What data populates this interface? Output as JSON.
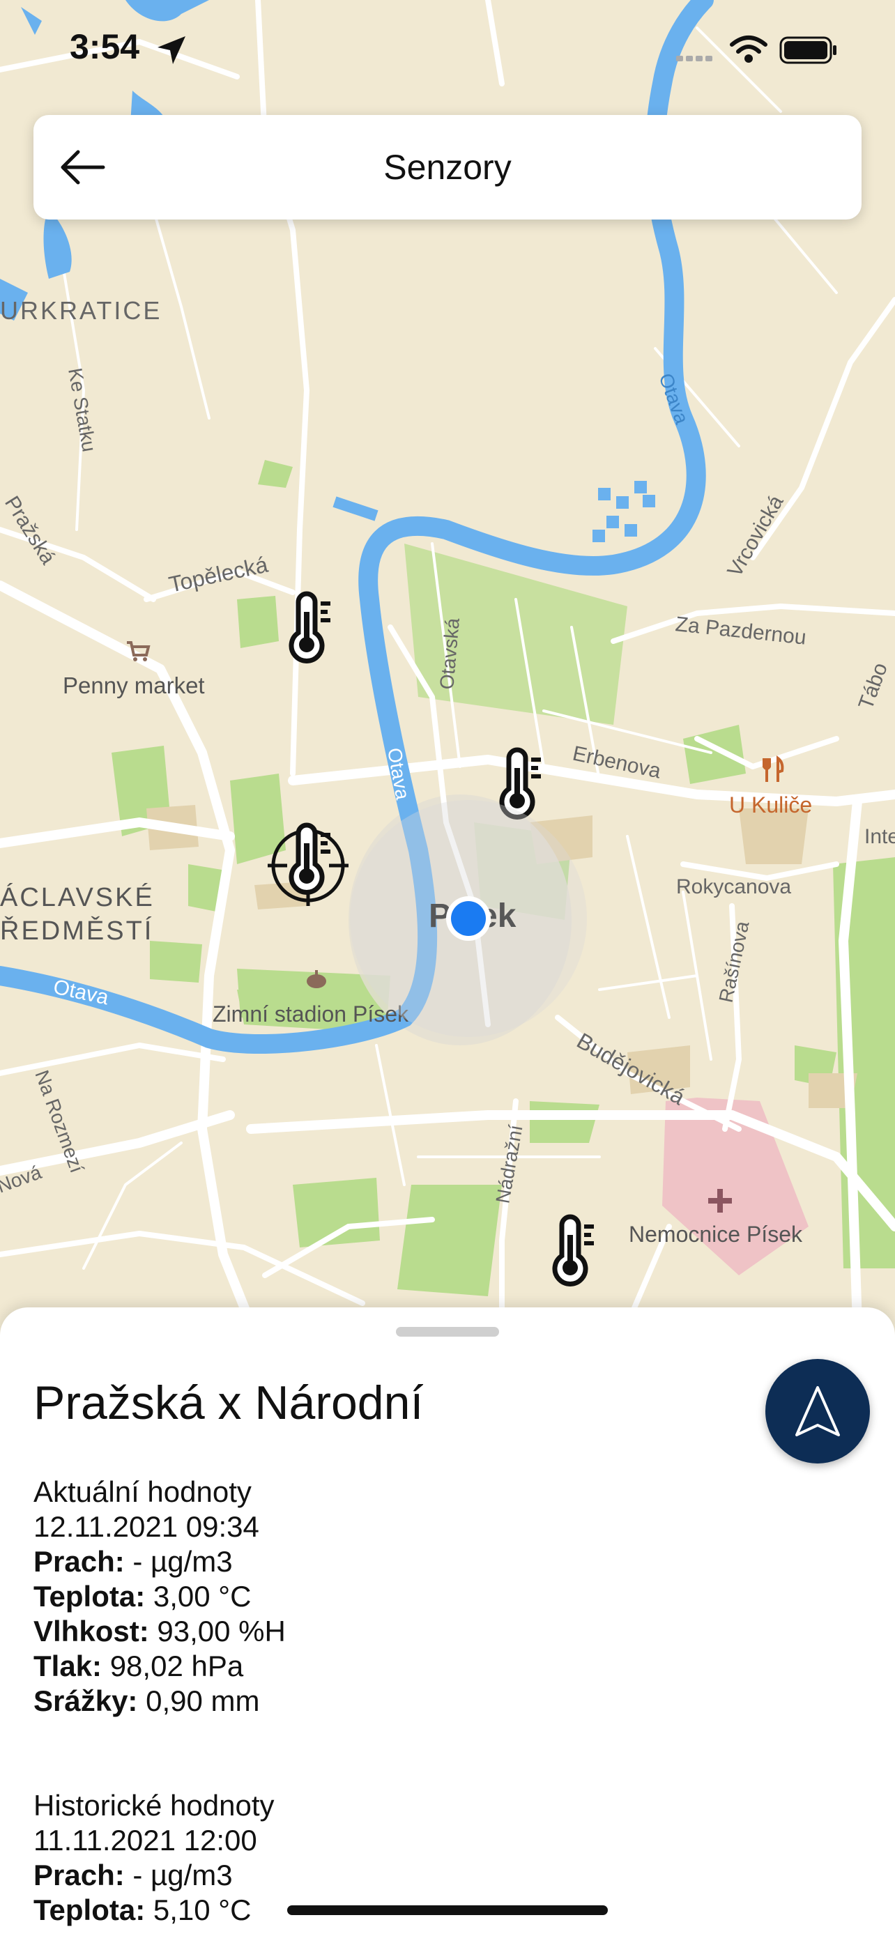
{
  "status_bar": {
    "time": "3:54"
  },
  "header": {
    "title": "Senzory"
  },
  "map": {
    "labels": {
      "area_north": "URKRATICE",
      "street_ke_statku": "Ke Statku",
      "street_prazska": "Pražská",
      "street_topelecka": "Topělecká",
      "poi_penny": "Penny market",
      "street_otavska": "Otavská",
      "river_otava_north": "Otava",
      "river_otava_center": "Otava",
      "river_otava_west": "Otava",
      "street_vrcovicka": "Vrcovická",
      "street_za_pazdernou": "Za Pazdernou",
      "street_erbenova": "Erbenova",
      "poi_u_kulice": "U Kuliče",
      "street_tabor": "Tábo",
      "area_inte": "Inte",
      "area_vaclavske_1": "ÁCLAVSKÉ",
      "area_vaclavske_2": "ŘEDMĚSTÍ",
      "city_pisek": "Písek",
      "street_rokycanova": "Rokycanova",
      "street_rasinova": "Rašínova",
      "poi_zimni_stadion": "Zimní stadion Písek",
      "street_budejovicka": "Budějovická",
      "street_na_rozmezi": "Na Rozmezí",
      "street_nova": "Nová",
      "street_nadrazni": "Nádražní",
      "poi_nemocnice": "Nemocnice Písek"
    },
    "colors": {
      "land": "#f1e9d2",
      "water": "#6ab1ee",
      "park": "#b9dc8e",
      "hospital": "#efc3c6",
      "road": "#ffffff",
      "user_location": "#1a7bf2"
    }
  },
  "sheet": {
    "title": "Pražská x Národní",
    "current": {
      "heading": "Aktuální hodnoty",
      "timestamp": "12.11.2021 09:34",
      "rows": [
        {
          "label": "Prach:",
          "value": " - µg/m3"
        },
        {
          "label": "Teplota:",
          "value": " 3,00 °C"
        },
        {
          "label": "Vlhkost:",
          "value": " 93,00 %H"
        },
        {
          "label": "Tlak:",
          "value": " 98,02 hPa"
        },
        {
          "label": "Srážky:",
          "value": " 0,90 mm"
        }
      ]
    },
    "history": {
      "heading": "Historické hodnoty",
      "timestamp": "11.11.2021 12:00",
      "rows": [
        {
          "label": "Prach:",
          "value": " - µg/m3"
        },
        {
          "label": "Teplota:",
          "value": " 5,10 °C"
        }
      ]
    }
  }
}
